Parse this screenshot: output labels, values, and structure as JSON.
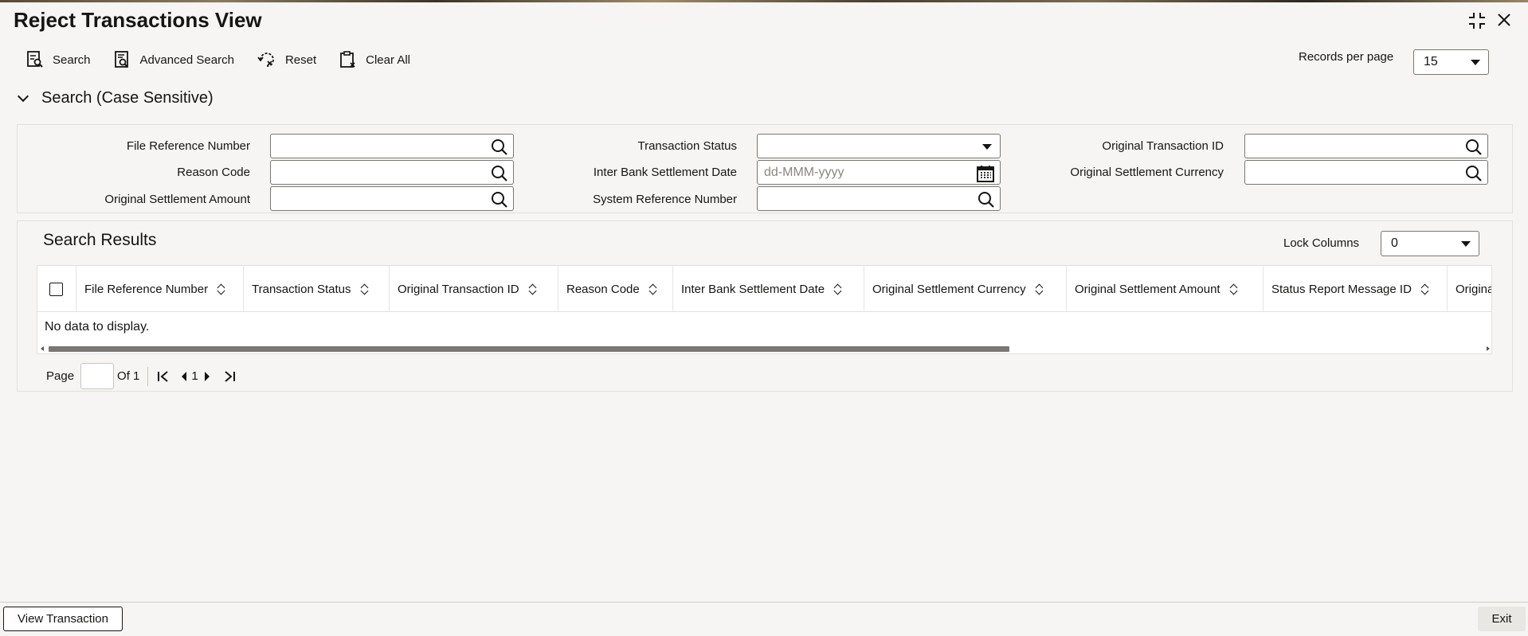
{
  "app": {
    "title": "Reject Transactions View",
    "minimize_glyph": "⤡",
    "close_glyph": "✕"
  },
  "toolbar": {
    "search": "Search",
    "advanced_search": "Advanced Search",
    "reset": "Reset",
    "clear_all": "Clear All",
    "records_per_page_label": "Records per page",
    "records_per_page_value": "15"
  },
  "search_section": {
    "title": "Search (Case Sensitive)",
    "fields": {
      "file_reference_number": "File Reference Number",
      "reason_code": "Reason Code",
      "original_settlement_amount": "Original Settlement Amount",
      "transaction_status": "Transaction Status",
      "inter_bank_settlement_date": "Inter Bank Settlement Date",
      "inter_bank_settlement_date_placeholder": "dd-MMM-yyyy",
      "system_reference_number": "System Reference Number",
      "original_transaction_id": "Original Transaction ID",
      "original_settlement_currency": "Original Settlement Currency"
    }
  },
  "results": {
    "title": "Search Results",
    "lock_columns_label": "Lock Columns",
    "lock_columns_value": "0",
    "columns": [
      "File Reference Number",
      "Transaction Status",
      "Original Transaction ID",
      "Reason Code",
      "Inter Bank Settlement Date",
      "Original Settlement Currency",
      "Original Settlement Amount",
      "Status Report Message ID",
      "Origina"
    ],
    "empty_text": "No data to display."
  },
  "pager": {
    "page_label": "Page",
    "of_label": "Of 1",
    "current_page": "1"
  },
  "footer": {
    "view_transaction": "View Transaction",
    "exit": "Exit"
  }
}
